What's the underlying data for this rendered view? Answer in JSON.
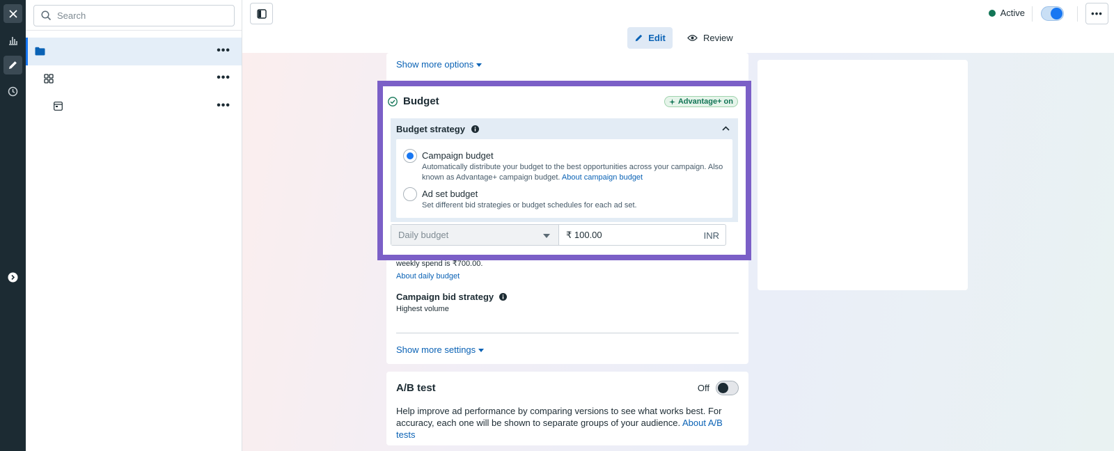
{
  "sidebar": {
    "search_placeholder": "Search",
    "rows": [
      {
        "icon": "folder-icon"
      },
      {
        "icon": "grid-icon"
      },
      {
        "icon": "ad-icon"
      }
    ]
  },
  "header": {
    "edit_label": "Edit",
    "review_label": "Review",
    "status_label": "Active"
  },
  "main": {
    "show_more_options": "Show more options",
    "budget": {
      "title": "Budget",
      "badge": "Advantage+ on",
      "strategy_label": "Budget strategy",
      "options": [
        {
          "title": "Campaign budget",
          "desc_line1": "Automatically distribute your budget to the best opportunities across your campaign. Also",
          "desc_line2": "known as Advantage+ campaign budget.",
          "link": "About campaign budget",
          "selected": true
        },
        {
          "title": "Ad set budget",
          "desc_line1": "Set different bid strategies or budget schedules for each ad set.",
          "selected": false
        }
      ],
      "budget_type": "Daily budget",
      "amount": "₹ 100.00",
      "currency": "INR"
    },
    "weekly_spend_text": "weekly spend is ₹700.00.",
    "about_daily_budget": "About daily budget",
    "bid_strategy_label": "Campaign bid strategy",
    "bid_strategy_value": "Highest volume",
    "show_more_settings": "Show more settings",
    "ab_test": {
      "title": "A/B test",
      "toggle_label": "Off",
      "desc_line1": "Help improve ad performance by comparing versions to see what works best. For",
      "desc_line2": "accuracy, each one will be shown to separate groups of your audience.",
      "link": "About A/B tests"
    }
  },
  "colors": {
    "accent": "#1877f2",
    "highlight": "#7b5fc7",
    "rail": "#1c2b33",
    "link": "#0a62b5",
    "active_dot": "#127556"
  }
}
